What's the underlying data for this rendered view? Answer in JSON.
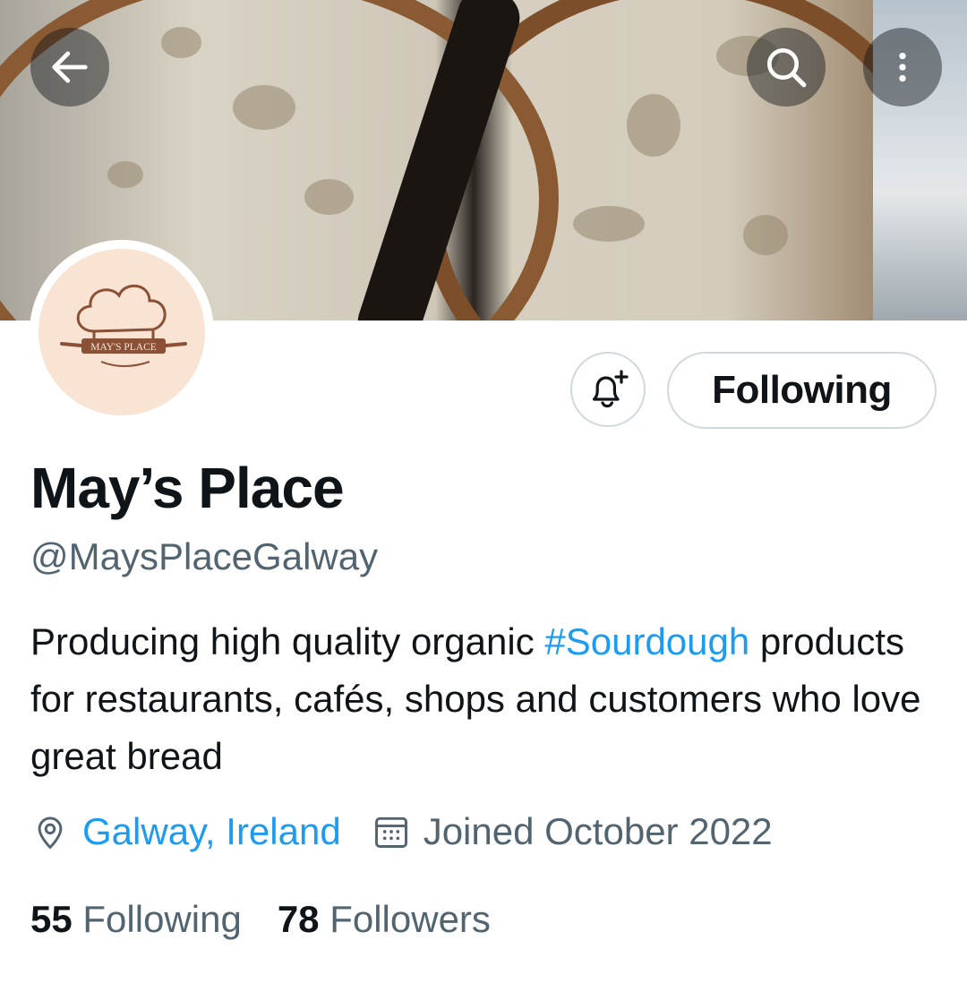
{
  "header": {
    "back_icon": "arrow-left-icon",
    "search_icon": "search-icon",
    "more_icon": "more-vertical-icon"
  },
  "avatar": {
    "logo_text": "MAY'S PLACE",
    "background": "#f9e3d3",
    "ink": "#8a5136"
  },
  "actions": {
    "notify_icon": "bell-plus-icon",
    "following_label": "Following"
  },
  "profile": {
    "name": "May’s Place",
    "handle": "@MaysPlaceGalway",
    "bio_before": "Producing high quality organic ",
    "bio_hashtag": "#Sourdough",
    "bio_after": " products for restaurants, cafés, shops and customers who love great bread",
    "location": "Galway, Ireland",
    "joined": "Joined October 2022"
  },
  "stats": {
    "following_count": "55",
    "following_label": "Following",
    "followers_count": "78",
    "followers_label": "Followers"
  },
  "colors": {
    "link": "#1d9bf0",
    "secondary_text": "#536471",
    "primary_text": "#0f1419",
    "border": "#cfd9de"
  }
}
